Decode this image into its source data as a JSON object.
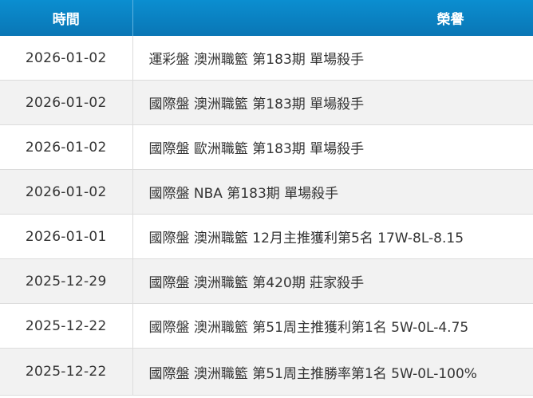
{
  "header": {
    "date_label": "時間",
    "honor_label": "榮譽"
  },
  "rows": [
    {
      "date": "2026-01-02",
      "honor": "運彩盤 澳洲職籃 第183期 單場殺手"
    },
    {
      "date": "2026-01-02",
      "honor": "國際盤 澳洲職籃 第183期 單場殺手"
    },
    {
      "date": "2026-01-02",
      "honor": "國際盤 歐洲職籃 第183期 單場殺手"
    },
    {
      "date": "2026-01-02",
      "honor": "國際盤 NBA 第183期 單場殺手"
    },
    {
      "date": "2026-01-01",
      "honor": "國際盤 澳洲職籃 12月主推獲利第5名 17W-8L-8.15"
    },
    {
      "date": "2025-12-29",
      "honor": "國際盤 澳洲職籃 第420期 莊家殺手"
    },
    {
      "date": "2025-12-22",
      "honor": "國際盤 澳洲職籃 第51周主推獲利第1名 5W-0L-4.75"
    },
    {
      "date": "2025-12-22",
      "honor": "國際盤 澳洲職籃 第51周主推勝率第1名 5W-0L-100%"
    }
  ]
}
